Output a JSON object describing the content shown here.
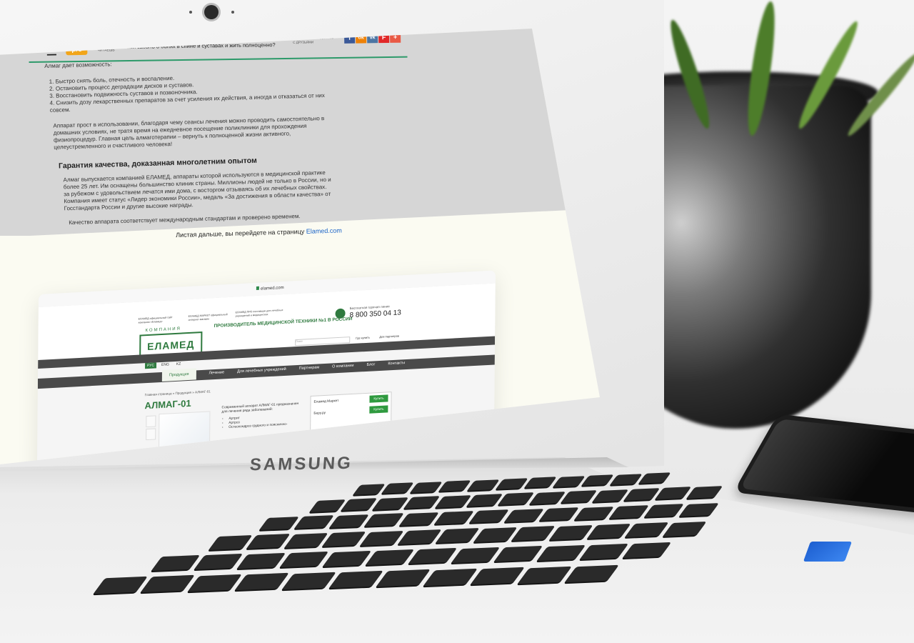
{
  "laptop_brand": "SAMSUNG",
  "topbar": {
    "logo_top": "tele",
    "logo_bottom": "pro",
    "now_reading": "СЕЙЧАС ТЫ ЧИТАЕШЬ",
    "headline": "Как забыть о болях в спине и суставах и жить полноценно?",
    "share_label": "ИНТЕРЕСНО? ПОДЕЛИСЬ С ДРУЗЬЯМИ",
    "share_buttons": [
      {
        "label": "f",
        "icon": "facebook-icon",
        "color": "#3b5998"
      },
      {
        "label": "ok",
        "icon": "odnoklassniki-icon",
        "color": "#ee8208"
      },
      {
        "label": "vk",
        "icon": "vk-icon",
        "color": "#4c75a3"
      },
      {
        "label": "F",
        "icon": "flipboard-icon",
        "color": "#e12828"
      },
      {
        "label": "+",
        "icon": "plus-icon",
        "color": "#e95a45"
      }
    ]
  },
  "article": {
    "intro": "Алмаг дает возможность:",
    "benefits": [
      "1. Быстро снять боль, отечность и воспаление.",
      "2. Остановить процесс деградации дисков и суставов.",
      "3. Восстановить подвижность суставов и позвоночника.",
      "4. Снизить дозу лекарственных препаратов за счет усиления их действия, а иногда и отказаться от них совсем."
    ],
    "paragraph1": "Аппарат прост в использовании, благодаря чему сеансы лечения можно проводить самостоятельно в домашних условиях, не тратя время на ежедневное посещение поликлиники для прохождения физиопроцедур. Главная цель алмаготерапии – вернуть к полноценной жизни активного, целеустремленного и счастливого человека!",
    "heading": "Гарантия качества, доказанная многолетним опытом",
    "paragraph2": "Алмаг выпускается компанией ЕЛАМЕД, аппараты которой используются в медицинской практике более 25 лет. Им оснащены большинство клиник страны. Миллионы людей не только в России, но и за рубежом с удовольствием лечатся ими дома, с восторгом отзываясь об их лечебных свойствах. Компания имеет статус «Лидер экономики России», медаль «За достижения в области качества» от Госстандарта России и другие высокие награды.",
    "cut_line": "Качество аппарата соответствует международным стандартам и проверено временем."
  },
  "continue_note": {
    "text": "Листая дальше, вы перейдете на страницу ",
    "link": "Elamed.com"
  },
  "preview": {
    "url": "elamed.com",
    "header_notes": [
      "ЕЛАМЕД официальный сайт компании «Еламед»",
      "ЕЛАМЕД МАРКЕТ официальный интернет-магазин",
      "ЕЛАМЕД ПРО поставщик для лечебных учреждений и медицинских"
    ],
    "brand_sub": "КОМПАНИЯ",
    "brand": "ЕЛАМЕД",
    "tagline": "ПРОИЗВОДИТЕЛЬ МЕДИЦИНСКОЙ ТЕХНИКИ №1 В РОССИИ",
    "hotline_label": "Бесплатная горячая линия",
    "hotline": "8 800 350 04 13",
    "search_placeholder": "Поиск",
    "where_to_buy": "Где купить",
    "for_partners": "Для партнеров",
    "langs": [
      "РУС",
      "ENG",
      "KZ"
    ],
    "nav": [
      "Продукция",
      "Лечение",
      "Для лечебных учреждений",
      "Партнерам",
      "О компании",
      "Блог",
      "Контакты"
    ],
    "breadcrumbs": "Главная страница  »  Продукция  »  АЛМАГ-01",
    "product_title": "АЛМАГ-01",
    "description": "Современный аппарат АЛМАГ-01 предназначен для лечения ряда заболеваний:",
    "conditions": [
      "Артрит",
      "Артроз",
      "Остеохондроз грудного и пояснично-"
    ],
    "buy_options": [
      {
        "label": "Еламед Маркет",
        "button": "Купить"
      },
      {
        "label": "Беру.ру",
        "button": "Купить"
      }
    ]
  }
}
